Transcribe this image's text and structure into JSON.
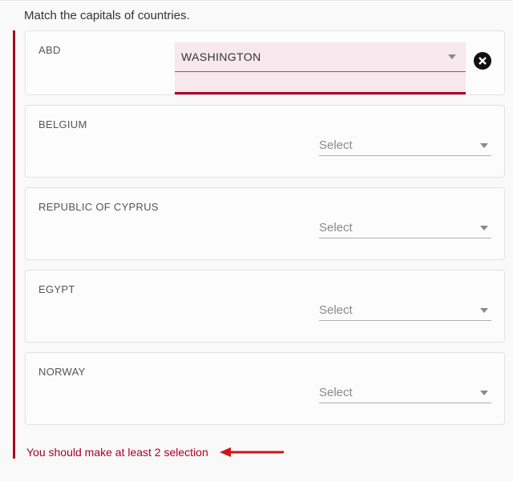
{
  "question": "Match the capitals of countries.",
  "selectPlaceholder": "Select",
  "rows": [
    {
      "country": "ABD",
      "value": "WASHINGTON",
      "hasValue": true,
      "clearable": true,
      "highlighted": true
    },
    {
      "country": "BELGIUM",
      "value": "",
      "hasValue": false
    },
    {
      "country": "REPUBLIC OF CYPRUS",
      "value": "",
      "hasValue": false
    },
    {
      "country": "EGYPT",
      "value": "",
      "hasValue": false
    },
    {
      "country": "NORWAY",
      "value": "",
      "hasValue": false
    }
  ],
  "error": "You should make at least 2 selection"
}
